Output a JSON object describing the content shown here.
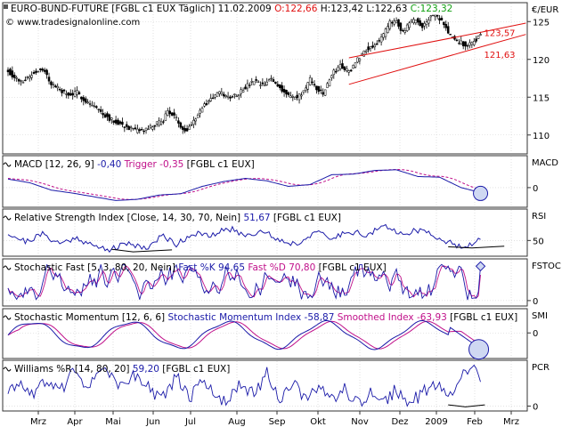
{
  "colors": {
    "price": "#000000",
    "primary": "#1a1aa8",
    "secondary": "#c0108a",
    "trend": "#e01010",
    "frame": "#333333",
    "close_value": "#e01010",
    "c_value": "#12a012",
    "grid": "#cfcfcf",
    "highlight_fill": "#cfd8f2"
  },
  "chart_data": [
    {
      "panel": "price",
      "type": "candlestick",
      "title": "EURO-BUND-FUTURE [FGBL c1 EUX  Täglich]",
      "header": {
        "date": "11.02.2009",
        "o_label": "O:122,66",
        "h_label": "H:123,42",
        "l_label": "L:122,63",
        "c_label": "C:123,32"
      },
      "watermark": "© www.tradesignalonline.com",
      "axis_label": "€/EUR",
      "y_ticks": [
        110,
        115,
        120,
        125
      ],
      "ylim": [
        107.5,
        127.5
      ],
      "x_ticks": [
        "Mrz",
        "Apr",
        "Mai",
        "Jun",
        "Jul",
        "Aug",
        "Sep",
        "Okt",
        "Nov",
        "Dez",
        "2009",
        "Feb",
        "Mrz"
      ],
      "trend_labels": [
        "123,57",
        "121,63"
      ],
      "series_key": [
        [
          0,
          118.5
        ],
        [
          3,
          117.6
        ],
        [
          6,
          117.0
        ],
        [
          10,
          117.8
        ],
        [
          14,
          118.6
        ],
        [
          17,
          118.3
        ],
        [
          20,
          116.8
        ],
        [
          24,
          116.0
        ],
        [
          28,
          115.2
        ],
        [
          32,
          115.6
        ],
        [
          36,
          114.5
        ],
        [
          40,
          113.8
        ],
        [
          44,
          112.8
        ],
        [
          48,
          112.0
        ],
        [
          52,
          111.5
        ],
        [
          56,
          110.9
        ],
        [
          60,
          110.5
        ],
        [
          64,
          110.7
        ],
        [
          68,
          111.3
        ],
        [
          72,
          112.0
        ],
        [
          74,
          113.2
        ],
        [
          77,
          112.5
        ],
        [
          80,
          111.2
        ],
        [
          83,
          110.6
        ],
        [
          86,
          112.0
        ],
        [
          90,
          113.6
        ],
        [
          94,
          114.8
        ],
        [
          98,
          115.6
        ],
        [
          102,
          115.0
        ],
        [
          106,
          115.4
        ],
        [
          110,
          116.3
        ],
        [
          114,
          117.1
        ],
        [
          118,
          116.5
        ],
        [
          122,
          117.4
        ],
        [
          126,
          116.3
        ],
        [
          130,
          115.2
        ],
        [
          134,
          114.9
        ],
        [
          137,
          115.8
        ],
        [
          140,
          117.3
        ],
        [
          143,
          116.2
        ],
        [
          146,
          115.4
        ],
        [
          150,
          118.0
        ],
        [
          154,
          119.2
        ],
        [
          158,
          118.3
        ],
        [
          162,
          120.0
        ],
        [
          166,
          121.4
        ],
        [
          170,
          121.9
        ],
        [
          174,
          123.2
        ],
        [
          177,
          124.8
        ],
        [
          180,
          125.2
        ],
        [
          183,
          123.5
        ],
        [
          186,
          124.7
        ],
        [
          189,
          125.3
        ],
        [
          192,
          124.2
        ],
        [
          195,
          125.5
        ],
        [
          198,
          125.9
        ],
        [
          201,
          125.0
        ],
        [
          204,
          123.6
        ],
        [
          207,
          122.5
        ],
        [
          210,
          122.2
        ],
        [
          213,
          121.8
        ],
        [
          216,
          122.4
        ],
        [
          219,
          123.32
        ]
      ],
      "trendlines": [
        {
          "points": [
            [
              158,
              120.2
            ],
            [
              219,
              123.57
            ],
            [
              240,
              124.8
            ]
          ]
        },
        {
          "points": [
            [
              158,
              116.7
            ],
            [
              219,
              121.63
            ],
            [
              240,
              123.3
            ]
          ]
        }
      ]
    },
    {
      "panel": "macd",
      "type": "line",
      "title": "MACD [12, 26, 9]",
      "value_label": "-0,40",
      "trigger_label": "Trigger",
      "trigger_value": "-0,35",
      "source": "[FGBL c1 EUX]",
      "axis_label": "MACD",
      "y_ticks": [
        0
      ],
      "ylim": [
        -1.6,
        2.6
      ],
      "series_key": [
        [
          0,
          0.7
        ],
        [
          10,
          0.4
        ],
        [
          20,
          -0.2
        ],
        [
          30,
          -0.45
        ],
        [
          40,
          -0.75
        ],
        [
          50,
          -1.05
        ],
        [
          60,
          -0.95
        ],
        [
          70,
          -0.6
        ],
        [
          80,
          -0.5
        ],
        [
          90,
          0.1
        ],
        [
          100,
          0.5
        ],
        [
          110,
          0.75
        ],
        [
          120,
          0.55
        ],
        [
          130,
          0.1
        ],
        [
          140,
          0.25
        ],
        [
          150,
          1.05
        ],
        [
          160,
          1.1
        ],
        [
          170,
          1.4
        ],
        [
          180,
          1.45
        ],
        [
          190,
          0.9
        ],
        [
          200,
          0.85
        ],
        [
          210,
          0.0
        ],
        [
          219,
          -0.4
        ]
      ],
      "highlight": [
        [
          219,
          -0.4
        ]
      ]
    },
    {
      "panel": "rsi",
      "type": "line",
      "title": "Relative Strength Index [Close, 14, 30, 70, Nein]",
      "value_label": "51,67",
      "source": "[FGBL c1 EUX]",
      "axis_label": "RSI",
      "y_ticks": [
        50
      ],
      "ylim": [
        25,
        100
      ],
      "series_key": [
        [
          0,
          62
        ],
        [
          8,
          48
        ],
        [
          16,
          60
        ],
        [
          24,
          45
        ],
        [
          32,
          55
        ],
        [
          40,
          40
        ],
        [
          48,
          36
        ],
        [
          56,
          46
        ],
        [
          64,
          38
        ],
        [
          72,
          58
        ],
        [
          78,
          44
        ],
        [
          86,
          62
        ],
        [
          94,
          56
        ],
        [
          102,
          70
        ],
        [
          110,
          58
        ],
        [
          118,
          66
        ],
        [
          126,
          50
        ],
        [
          134,
          44
        ],
        [
          142,
          64
        ],
        [
          150,
          52
        ],
        [
          158,
          66
        ],
        [
          166,
          58
        ],
        [
          174,
          72
        ],
        [
          182,
          62
        ],
        [
          190,
          66
        ],
        [
          198,
          58
        ],
        [
          204,
          46
        ],
        [
          210,
          42
        ],
        [
          216,
          44
        ],
        [
          219,
          51.67
        ]
      ]
    },
    {
      "panel": "fstoch",
      "type": "line",
      "title": "Stochastic Fast [5, 3, 80, 20, Nein]",
      "k_label": "Fast %K",
      "k_value": "94,65",
      "d_label": "Fast %D",
      "d_value": "70,80",
      "source": "[FGBL c1 EUX]",
      "axis_label": "FSTOC",
      "y_ticks": [
        0
      ],
      "ylim": [
        -15,
        115
      ],
      "highlight": [
        [
          219,
          94.65
        ]
      ]
    },
    {
      "panel": "smi",
      "type": "line",
      "title": "Stochastic Momentum [12, 6, 6]",
      "smi_label": "Stochastic Momentum Index",
      "smi_value": "-58,87",
      "smoothed_label": "Smoothed Index",
      "smoothed_value": "-63,93",
      "source": "[FGBL c1 EUX]",
      "axis_label": "SMI",
      "y_ticks": [
        0
      ],
      "ylim": [
        -95,
        90
      ],
      "highlight": [
        [
          219,
          -58.87
        ]
      ]
    },
    {
      "panel": "williams",
      "type": "line",
      "title": "Williams %R [14, 80, 20]",
      "value_label": "59,20",
      "source": "[FGBL c1 EUX]",
      "axis_label": "PCR",
      "y_ticks": [
        0
      ],
      "ylim": [
        -12,
        112
      ],
      "series_key": [
        [
          0,
          35
        ],
        [
          6,
          55
        ],
        [
          12,
          25
        ],
        [
          18,
          70
        ],
        [
          24,
          30
        ],
        [
          30,
          80
        ],
        [
          36,
          45
        ],
        [
          42,
          90
        ],
        [
          48,
          70
        ],
        [
          54,
          40
        ],
        [
          60,
          85
        ],
        [
          66,
          35
        ],
        [
          72,
          20
        ],
        [
          78,
          75
        ],
        [
          84,
          15
        ],
        [
          90,
          60
        ],
        [
          96,
          30
        ],
        [
          102,
          10
        ],
        [
          108,
          55
        ],
        [
          114,
          25
        ],
        [
          120,
          80
        ],
        [
          126,
          20
        ],
        [
          132,
          65
        ],
        [
          138,
          10
        ],
        [
          144,
          50
        ],
        [
          150,
          15
        ],
        [
          156,
          40
        ],
        [
          162,
          5
        ],
        [
          168,
          30
        ],
        [
          174,
          8
        ],
        [
          180,
          40
        ],
        [
          186,
          5
        ],
        [
          192,
          30
        ],
        [
          198,
          55
        ],
        [
          204,
          20
        ],
        [
          210,
          85
        ],
        [
          216,
          90
        ],
        [
          219,
          59.2
        ]
      ]
    }
  ]
}
